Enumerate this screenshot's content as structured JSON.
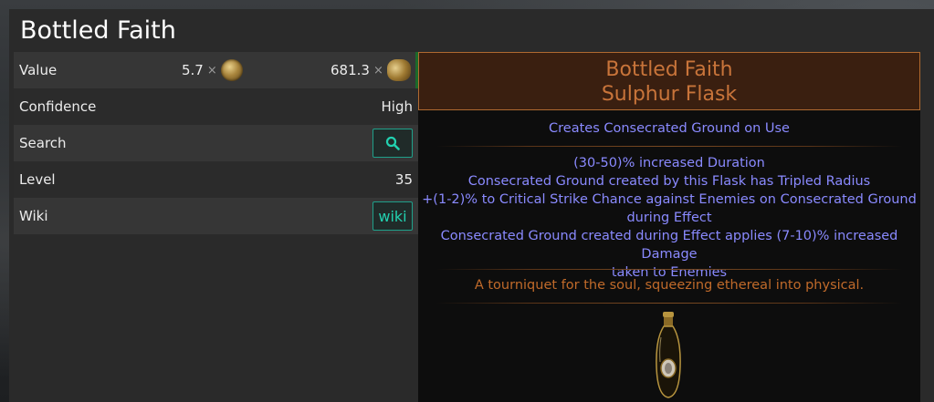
{
  "window": {
    "title": "Bottled Faith"
  },
  "rows": {
    "value": {
      "label": "Value",
      "chaos_value": "5.7",
      "exalt_value": "681.3",
      "times": "×",
      "chaos_icon": "chaos-orb-icon",
      "exalt_icon": "divine-orb-icon"
    },
    "confidence": {
      "label": "Confidence",
      "value": "High"
    },
    "search": {
      "label": "Search",
      "icon": "search-icon"
    },
    "level": {
      "label": "Level",
      "value": "35"
    },
    "wiki": {
      "label": "Wiki",
      "button": "wiki"
    }
  },
  "item": {
    "name": "Bottled Faith",
    "base": "Sulphur Flask",
    "implicit": "Creates Consecrated Ground on Use",
    "mods": [
      "(30-50)% increased Duration",
      "Consecrated Ground created by this Flask has Tripled Radius",
      "+(1-2)% to Critical Strike Chance against Enemies on Consecrated Ground",
      "during Effect",
      "Consecrated Ground created during Effect applies (7-10)% increased Damage",
      "taken to Enemies"
    ],
    "flavour": "A tourniquet for the soul, squeezing ethereal into physical.",
    "image_icon": "flask-icon"
  },
  "colors": {
    "unique": "#c8743a",
    "magic_mod": "#8a8aff",
    "accent": "#22d1b0"
  }
}
